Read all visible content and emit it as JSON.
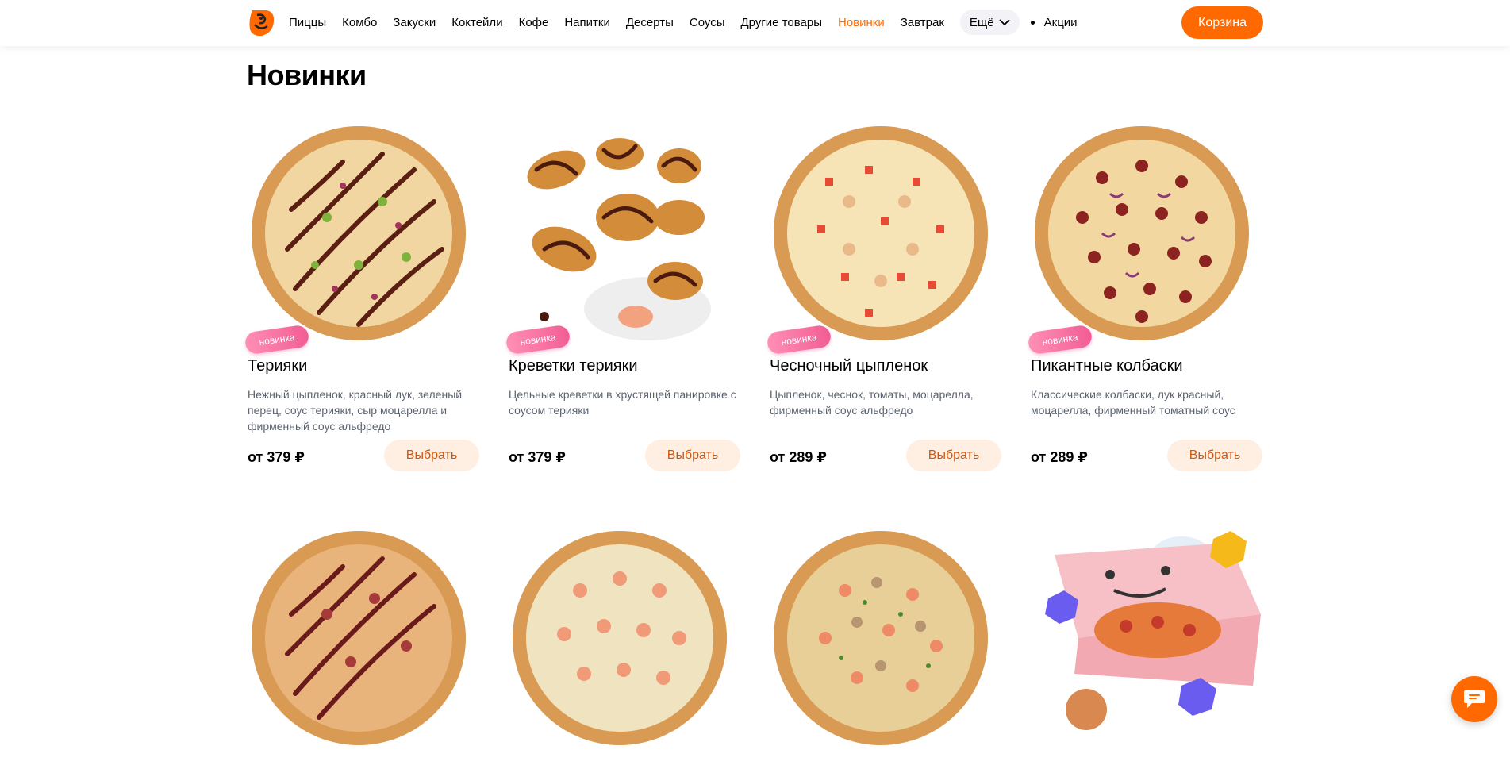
{
  "brand": {
    "accent": "#ff6900",
    "logo_icon": "dodo-logo-icon"
  },
  "header": {
    "nav": [
      {
        "label": "Пиццы"
      },
      {
        "label": "Комбо"
      },
      {
        "label": "Закуски"
      },
      {
        "label": "Коктейли"
      },
      {
        "label": "Кофе"
      },
      {
        "label": "Напитки"
      },
      {
        "label": "Десерты"
      },
      {
        "label": "Соусы"
      },
      {
        "label": "Другие товары"
      },
      {
        "label": "Новинки",
        "active": true
      },
      {
        "label": "Завтрак"
      }
    ],
    "more_label": "Ещё",
    "promo_label": "Акции",
    "cart_label": "Корзина"
  },
  "section_title": "Новинки",
  "products": [
    {
      "name": "Терияки",
      "description": "Нежный цыпленок, красный лук, зеленый перец, соус терияки, сыр моцарелла и фирменный соус альфредо",
      "price": "от 379 ₽",
      "badge": "новинка",
      "button": "Выбрать",
      "image": "teriyaki-pizza-image"
    },
    {
      "name": "Креветки терияки",
      "description": "Цельные креветки в хрустящей панировке с соусом терияки",
      "price": "от 379 ₽",
      "badge": "новинка",
      "button": "Выбрать",
      "image": "teriyaki-shrimp-image"
    },
    {
      "name": "Чесночный цыпленок",
      "description": "Цыпленок, чеснок, томаты, моцарелла, фирменный соус альфредо",
      "price": "от 289 ₽",
      "badge": "новинка",
      "button": "Выбрать",
      "image": "garlic-chicken-pizza-image"
    },
    {
      "name": "Пикантные колбаски",
      "description": "Классические колбаски, лук красный, моцарелла, фирменный томатный соус",
      "price": "от 289 ₽",
      "badge": "новинка",
      "button": "Выбрать",
      "image": "spicy-sausage-pizza-image"
    }
  ],
  "products_row2": [
    {
      "image": "bbq-sausage-pizza-image"
    },
    {
      "image": "shrimp-cheese-pizza-image"
    },
    {
      "image": "shrimp-mushroom-pizza-image"
    },
    {
      "image": "pizza-box-toy-image"
    }
  ]
}
